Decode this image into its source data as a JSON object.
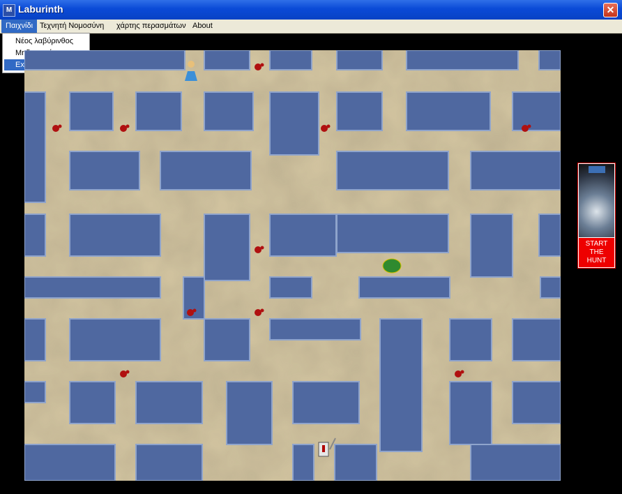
{
  "window": {
    "title": "Laburinth",
    "icon": "M-app-icon",
    "close_glyph": "✕"
  },
  "menubar": {
    "items": [
      "Παιχνίδι",
      "Τεχνητή Νομοσύνη",
      "χάρτης περασμάτων",
      "About"
    ],
    "active_index": 0
  },
  "dropdown": {
    "items": [
      "Νέος λαβύρινθος",
      "Μηδενισμός",
      "Exit"
    ],
    "highlighted_index": 2
  },
  "game": {
    "wall_color": "#4f68a0",
    "floor_color": "#d2c4a0",
    "sprites": [
      "princess-sprite",
      "knight-sprite",
      "monster-sprite",
      "blood-splatter"
    ]
  },
  "side_panel": {
    "poster_icon": "monster-poster",
    "hunt_lines": [
      "START",
      "THE",
      "HUNT"
    ],
    "hunt_color": "#ee0000"
  }
}
